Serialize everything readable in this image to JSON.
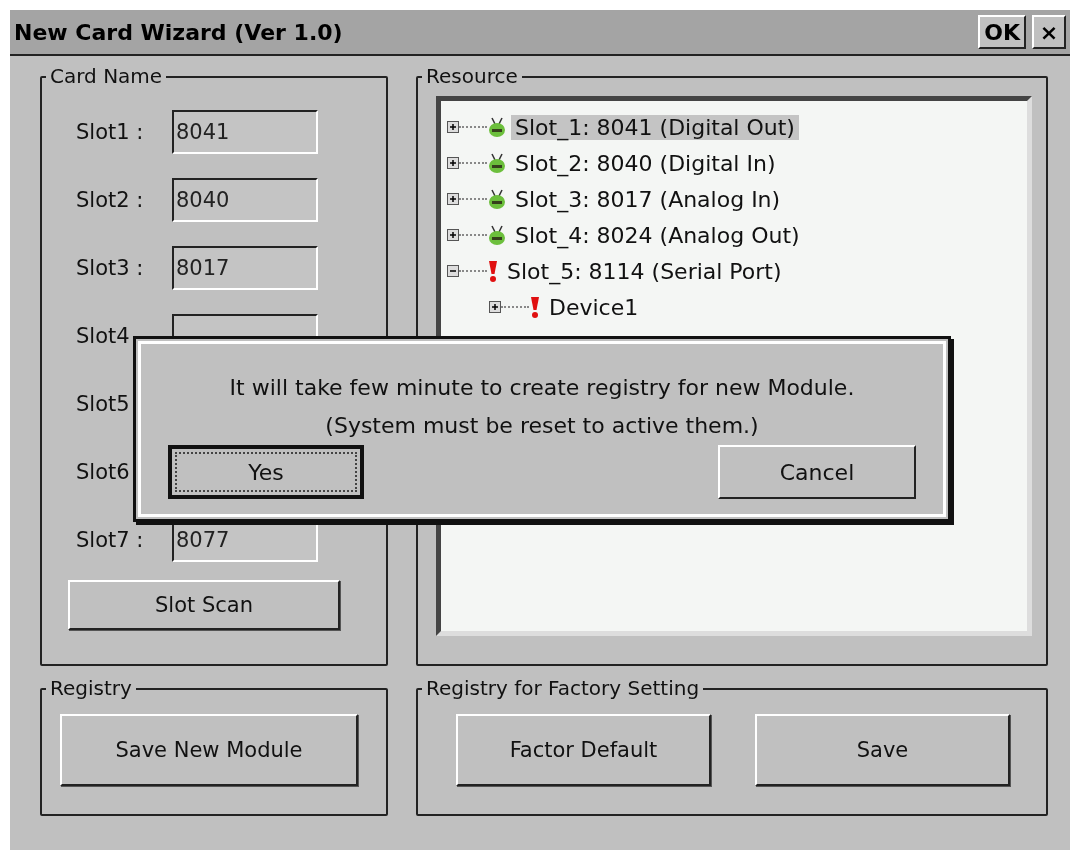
{
  "window": {
    "title": "New Card Wizard (Ver 1.0)",
    "ok_label": "OK",
    "close_label": "×"
  },
  "card_name": {
    "title": "Card Name",
    "slots": [
      {
        "label": "Slot1 :",
        "value": "8041"
      },
      {
        "label": "Slot2 :",
        "value": "8040"
      },
      {
        "label": "Slot3 :",
        "value": "8017"
      },
      {
        "label": "Slot4",
        "field_visible": true
      },
      {
        "label": "Slot5"
      },
      {
        "label": "Slot6"
      },
      {
        "label": "Slot7 :",
        "value": "8077"
      }
    ],
    "scan_button": "Slot Scan"
  },
  "resource": {
    "title": "Resource",
    "tree": [
      {
        "label": "Slot_1: 8041 (Digital Out)",
        "kind": "ok",
        "expanded": false,
        "selected": true
      },
      {
        "label": "Slot_2: 8040 (Digital In)",
        "kind": "ok",
        "expanded": false,
        "selected": false
      },
      {
        "label": "Slot_3: 8017 (Analog In)",
        "kind": "ok",
        "expanded": false,
        "selected": false
      },
      {
        "label": "Slot_4: 8024 (Analog Out)",
        "kind": "ok",
        "expanded": false,
        "selected": false
      },
      {
        "label": "Slot_5: 8114 (Serial Port)",
        "kind": "error",
        "expanded": true,
        "selected": false,
        "children": [
          {
            "label": "Device1",
            "kind": "error",
            "expanded": false,
            "selected": false
          }
        ]
      }
    ]
  },
  "registry": {
    "title": "Registry",
    "buttons": [
      "Save New Module"
    ]
  },
  "factory": {
    "title": "Registry for Factory Setting",
    "buttons": [
      "Factor Default",
      "Save"
    ]
  },
  "dialog": {
    "message": [
      "It will take few minute to create registry for new Module.",
      "(System must be reset to active them.)"
    ],
    "buttons": [
      {
        "label": "Yes",
        "selected": true
      },
      {
        "label": "Cancel",
        "selected": false
      }
    ]
  }
}
